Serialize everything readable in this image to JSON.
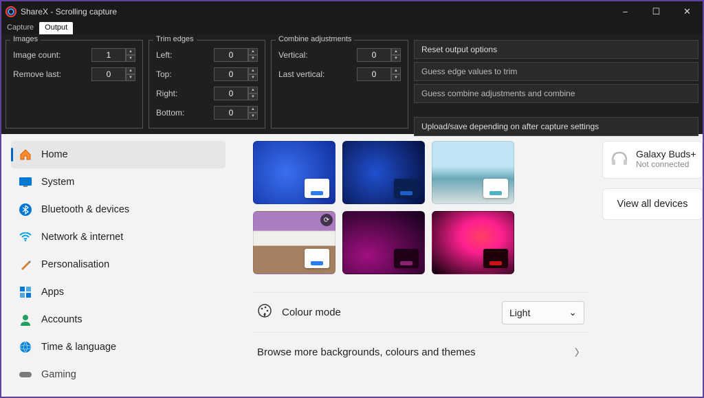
{
  "window": {
    "title": "ShareX - Scrolling capture",
    "minimize": "−",
    "maximize": "☐",
    "close": "✕"
  },
  "tabs": {
    "capture": "Capture",
    "output": "Output"
  },
  "images_fs": {
    "legend": "Images",
    "count_label": "Image count:",
    "count_value": "1",
    "remove_label": "Remove last:",
    "remove_value": "0"
  },
  "trim_fs": {
    "legend": "Trim edges",
    "left_label": "Left:",
    "left_value": "0",
    "top_label": "Top:",
    "top_value": "0",
    "right_label": "Right:",
    "right_value": "0",
    "bottom_label": "Bottom:",
    "bottom_value": "0"
  },
  "combine_fs": {
    "legend": "Combine adjustments",
    "vertical_label": "Vertical:",
    "vertical_value": "0",
    "last_label": "Last vertical:",
    "last_value": "0"
  },
  "actions": {
    "reset": "Reset output options",
    "guess_edge": "Guess edge values to trim",
    "guess_combine": "Guess combine adjustments and combine",
    "upload": "Upload/save depending on after capture settings"
  },
  "sidebar": {
    "items": [
      {
        "label": "Home"
      },
      {
        "label": "System"
      },
      {
        "label": "Bluetooth & devices"
      },
      {
        "label": "Network & internet"
      },
      {
        "label": "Personalisation"
      },
      {
        "label": "Apps"
      },
      {
        "label": "Accounts"
      },
      {
        "label": "Time & language"
      },
      {
        "label": "Gaming"
      }
    ]
  },
  "themes": {
    "accents": [
      "#2b7de9",
      "#1e5fc4",
      "#4fb0c6",
      "#2b7de9",
      "#8a2270",
      "#c81414"
    ]
  },
  "colour_mode": {
    "label": "Colour mode",
    "value": "Light"
  },
  "browse": {
    "label": "Browse more backgrounds, colours and themes"
  },
  "device": {
    "name": "Galaxy Buds+",
    "status": "Not connected"
  },
  "view_all": "View all devices"
}
